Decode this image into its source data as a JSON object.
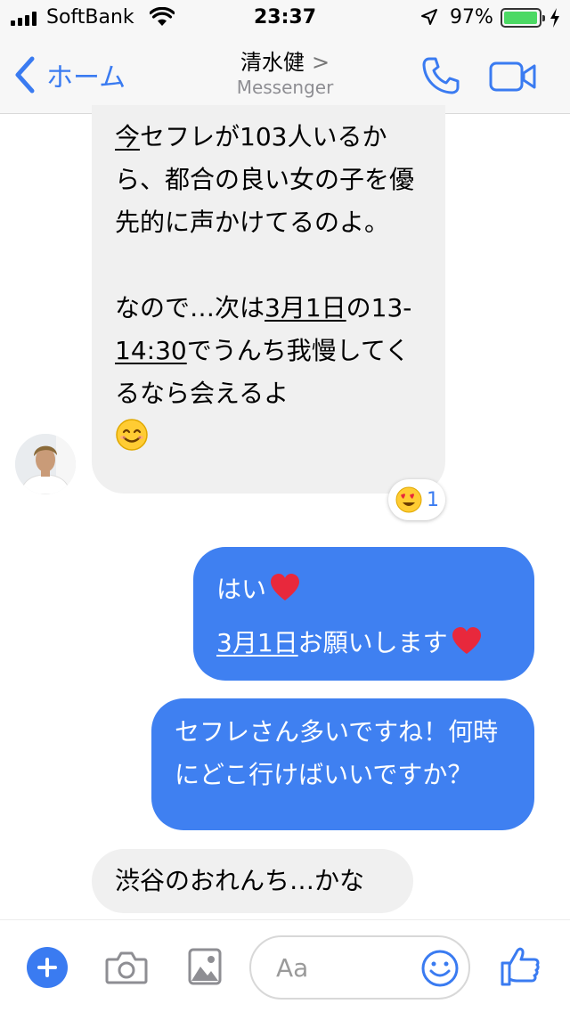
{
  "status_bar": {
    "carrier": "SoftBank",
    "time": "23:37",
    "battery_percent": "97%",
    "battery_level": 0.97,
    "icons": [
      "signal-icon",
      "wifi-icon",
      "location-arrow-icon",
      "battery-icon",
      "charging-bolt-icon"
    ]
  },
  "nav": {
    "back_label": "ホーム",
    "contact_name": "清水健",
    "subtitle": "Messenger",
    "icons": [
      "chevron-left-icon",
      "chevron-right-icon",
      "phone-icon",
      "video-camera-icon"
    ],
    "accent_color": "#3a7bf1"
  },
  "messages": [
    {
      "sender": "contact",
      "part1": "今",
      "part2": "セフレが103人いるから、都合の良い女の子を優先的に声かけてるのよ。",
      "part3": "なので…次は",
      "date": "3月1日",
      "part4": "の",
      "part5": "13-",
      "time_range": "14:30",
      "part6": "でうんち我慢してくるなら会えるよ",
      "emoji": "smiling-face-icon",
      "reaction": {
        "emoji": "heart-eyes-icon",
        "count": "1"
      }
    },
    {
      "sender": "me",
      "line1": "はい",
      "line2_date": "3月1日",
      "line2_rest": "お願いします",
      "emoji": "red-heart-icon"
    },
    {
      "sender": "me",
      "text": "セフレさん多いですね！何時にどこ行けばいいですか？"
    },
    {
      "sender": "contact",
      "text": "渋谷のおれんち…かな"
    }
  ],
  "input_bar": {
    "placeholder": "Aa",
    "icons": [
      "plus-icon",
      "camera-icon",
      "image-icon",
      "emoji-icon",
      "thumbs-up-icon"
    ]
  },
  "colors": {
    "outgoing_bubble": "#3f80f1",
    "incoming_bubble": "#f0f0f0"
  }
}
